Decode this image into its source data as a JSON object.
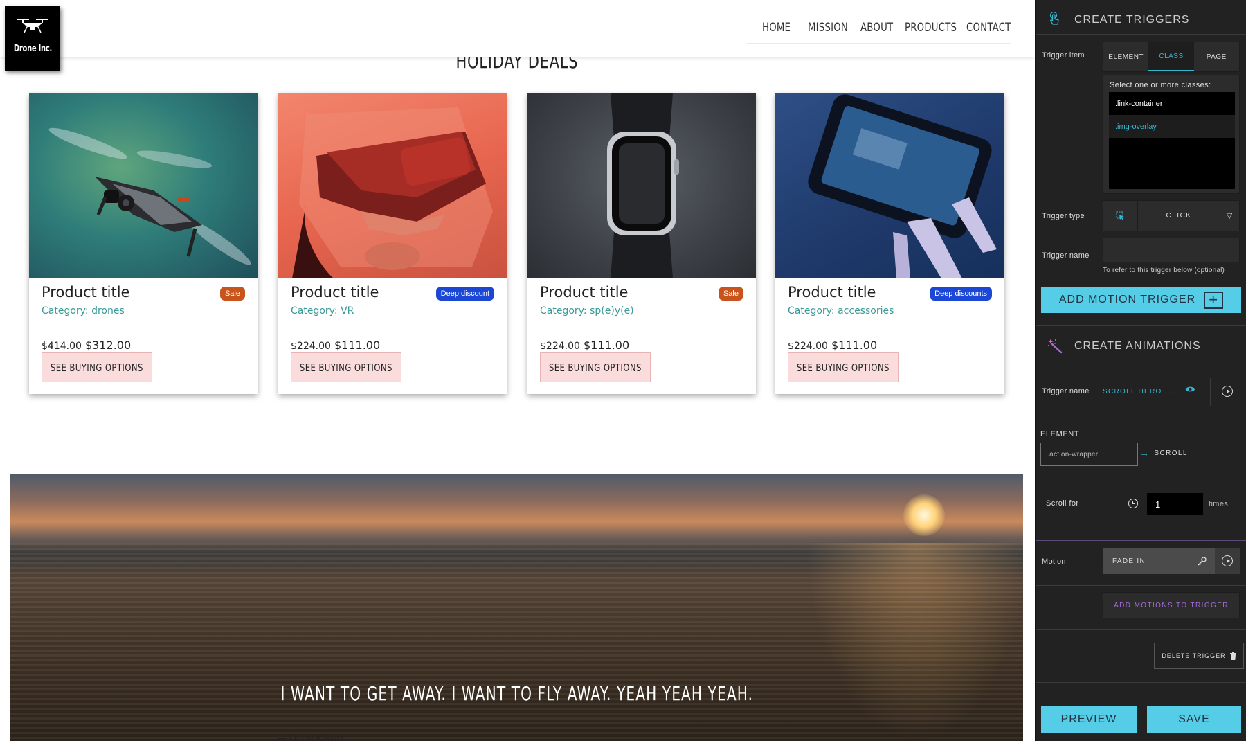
{
  "site": {
    "logo_text": "Drone Inc.",
    "nav": [
      "HOME",
      "MISSION",
      "ABOUT",
      "PRODUCTS",
      "CONTACT"
    ],
    "section_title": "HOLIDAY DEALS",
    "products": [
      {
        "title": "Product title",
        "badge": "Sale",
        "badge_color": "#c8541c",
        "category": "Category: drones",
        "old_price": "$414.00",
        "price": "$312.00",
        "button": "SEE BUYING OPTIONS",
        "image": "drone-photo"
      },
      {
        "title": "Product title",
        "badge": "Deep discount",
        "badge_color": "#1b47d4",
        "category": "Category: VR",
        "old_price": "$224.00",
        "price": "$111.00",
        "button": "SEE BUYING OPTIONS",
        "image": "vr-headset-photo"
      },
      {
        "title": "Product title",
        "badge": "Sale",
        "badge_color": "#c8541c",
        "category": "Category: sp(e)y(e)",
        "old_price": "$224.00",
        "price": "$111.00",
        "button": "SEE BUYING OPTIONS",
        "image": "smartwatch-photo"
      },
      {
        "title": "Product title",
        "badge": "Deep discounts",
        "badge_color": "#1b47d4",
        "category": "Category: accessories",
        "old_price": "$224.00",
        "price": "$111.00",
        "button": "SEE BUYING OPTIONS",
        "image": "controller-photo"
      }
    ],
    "quote": "I WANT TO GET AWAY. I WANT TO FLY AWAY. YEAH YEAH YEAH.",
    "quote_author": "— Lenny Kravitz"
  },
  "panel": {
    "triggers_title": "CREATE TRIGGERS",
    "trigger_item_label": "Trigger item",
    "tabs": [
      "ELEMENT",
      "CLASS",
      "PAGE"
    ],
    "active_tab": "CLASS",
    "class_hint": "Select one or more classes:",
    "classes": [
      ".link-container",
      ".img-overlay"
    ],
    "selected_class": ".img-overlay",
    "trigger_type_label": "Trigger type",
    "trigger_type_value": "CLICK",
    "trigger_name_label": "Trigger name",
    "trigger_name_value": "",
    "trigger_name_note": "To refer to this trigger below (optional)",
    "add_motion_trigger": "ADD MOTION TRIGGER",
    "animations_title": "CREATE ANIMATIONS",
    "anim_trigger_name_label": "Trigger name",
    "anim_trigger_name_value": "SCROLL HERO ...",
    "element_label": "ELEMENT",
    "element_value": ".action-wrapper",
    "element_action": "SCROLL",
    "scroll_for_label": "Scroll for",
    "scroll_for_value": "1",
    "scroll_for_unit": "times",
    "motion_label": "Motion",
    "motion_value": "FADE IN",
    "add_motions": "ADD MOTIONS TO TRIGGER",
    "delete_trigger": "DELETE TRIGGER",
    "preview": "PREVIEW",
    "save": "SAVE",
    "accent_color": "#37b6d0",
    "button_color": "#55cde6",
    "add_motions_color": "#a36ad8"
  }
}
